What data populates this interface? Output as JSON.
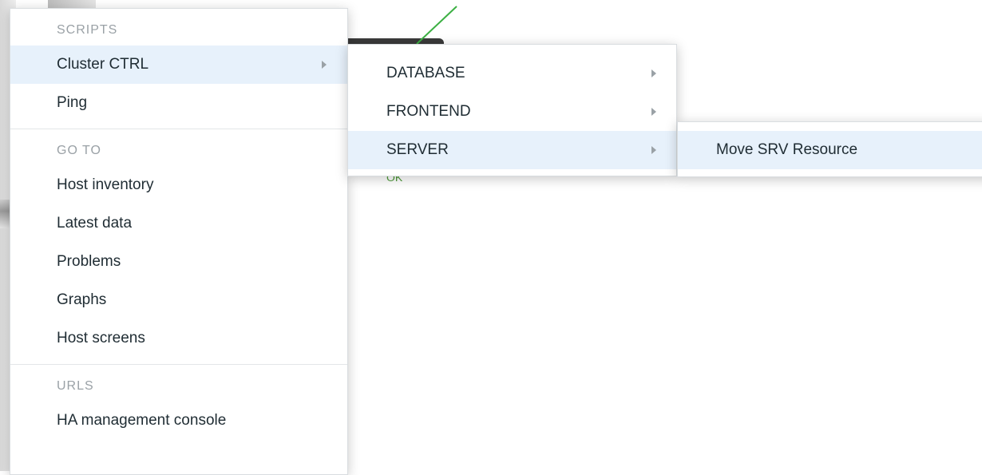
{
  "main_menu": {
    "sections": [
      {
        "header": "SCRIPTS",
        "items": [
          {
            "label": "Cluster CTRL",
            "has_submenu": true,
            "selected": true
          },
          {
            "label": "Ping",
            "has_submenu": false,
            "selected": false
          }
        ]
      },
      {
        "header": "GO TO",
        "items": [
          {
            "label": "Host inventory"
          },
          {
            "label": "Latest data"
          },
          {
            "label": "Problems"
          },
          {
            "label": "Graphs"
          },
          {
            "label": "Host screens"
          }
        ]
      },
      {
        "header": "URLS",
        "items": [
          {
            "label": "HA management console"
          }
        ]
      }
    ]
  },
  "submenu_cluster_ctrl": {
    "items": [
      {
        "label": "DATABASE",
        "has_submenu": true,
        "selected": false
      },
      {
        "label": "FRONTEND",
        "has_submenu": true,
        "selected": false
      },
      {
        "label": "SERVER",
        "has_submenu": true,
        "selected": true
      }
    ]
  },
  "submenu_server": {
    "items": [
      {
        "label": "Move SRV Resource",
        "selected": true
      }
    ]
  },
  "background": {
    "status_text": "OK"
  },
  "colors": {
    "selected_bg": "#e7f1fb",
    "header_text": "#9aa1a6",
    "item_text": "#1f2c33",
    "ok_green": "#4f9a3a",
    "map_line_green": "#3cb043"
  },
  "icons": {
    "submenu_indicator": "triangle-right-icon"
  }
}
